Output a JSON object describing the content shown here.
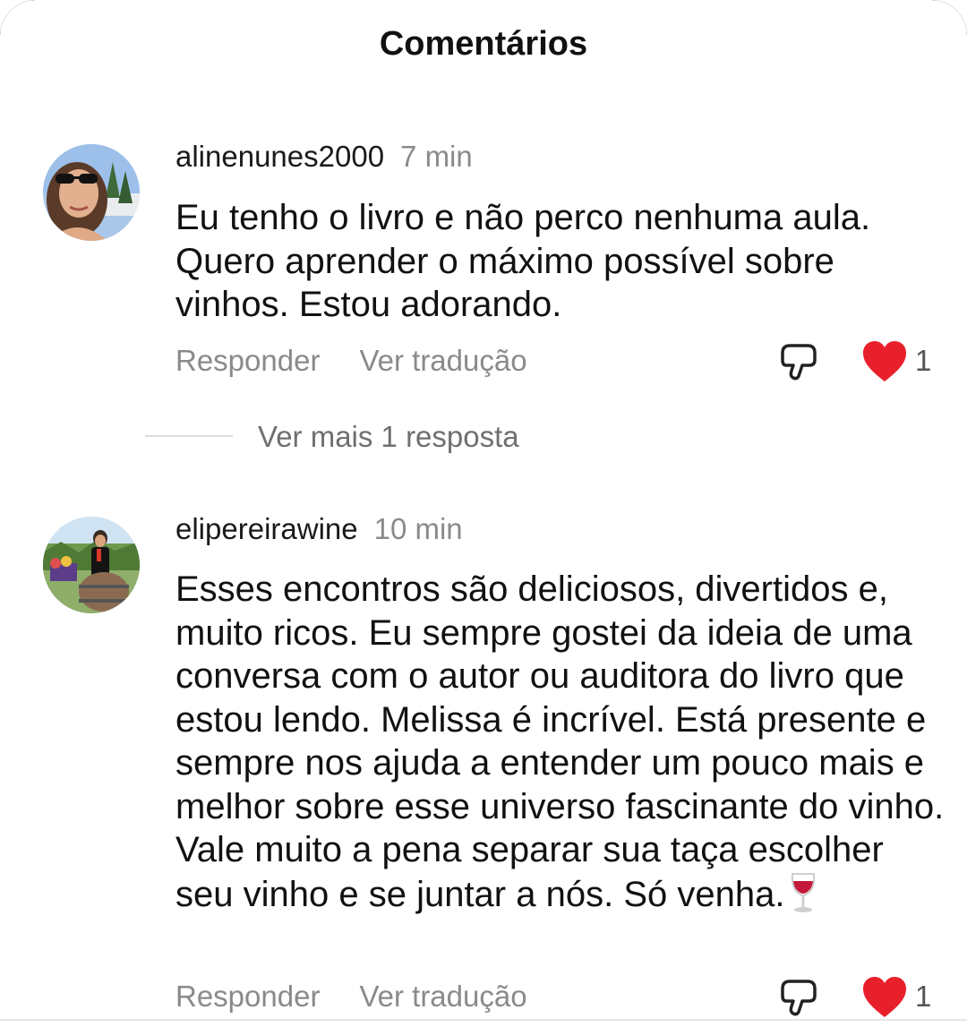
{
  "header": {
    "title": "Comentários"
  },
  "comments": [
    {
      "username": "alinenunes2000",
      "time": "7 min",
      "text": "Eu tenho o livro e não perco nenhuma aula. Quero aprender o máximo possível sobre vinhos. Estou adorando.",
      "reply_label": "Responder",
      "translate_label": "Ver tradução",
      "like_count": "1",
      "liked": true
    },
    {
      "username": "elipereirawine",
      "time": "10 min",
      "text": "Esses encontros são deliciosos, divertidos e, muito ricos. Eu sempre gostei da ideia de uma conversa com o autor ou auditora do livro que estou lendo. Melissa é incrível. Está presente e sempre nos ajuda a entender um pouco mais e melhor sobre esse universo fascinante do vinho. Vale muito a pena separar sua taça escolher seu vinho e se juntar a nós. Só venha.",
      "emoji": "wine-glass-icon",
      "reply_label": "Responder",
      "translate_label": "Ver tradução",
      "like_count": "1",
      "liked": true
    }
  ],
  "replies": {
    "label": "Ver mais 1 resposta"
  },
  "colors": {
    "like_red": "#e8202c",
    "muted_text": "#8a8a8a",
    "text": "#111111"
  },
  "icons": {
    "dislike": "thumbs-down-outline-icon",
    "like": "heart-filled-icon"
  }
}
